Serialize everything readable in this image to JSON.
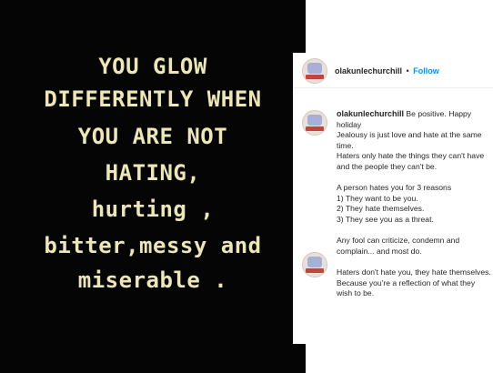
{
  "quote_image": {
    "lines": [
      "YOU GLOW",
      "DIFFERENTLY WHEN",
      "YOU ARE NOT",
      "HATING,",
      "hurting ,",
      "bitter,messy and",
      "miserable ."
    ]
  },
  "post": {
    "username": "olakunlechurchill",
    "separator": "•",
    "follow_label": "Follow",
    "caption_first": "Be positive. Happy holiday",
    "caption_block1": [
      "Jealousy is just love and hate at the same time.",
      "Haters only hate the things they can't have and the people they can't be."
    ],
    "caption_block2": [
      "A person hates you for 3 reasons",
      "1) They want to be you.",
      "2) They hate themselves.",
      "3) They see you as a threat."
    ],
    "caption_block3": [
      "Any fool can criticize, condemn and complain... and most do."
    ],
    "caption_block4": [
      "Haters don't hate you, they hate themselves. Because you're a reflection of what they wish to be."
    ]
  },
  "colors": {
    "quote_text": "#ece7b4",
    "image_background": "#050505",
    "follow_link": "#0095f6"
  }
}
